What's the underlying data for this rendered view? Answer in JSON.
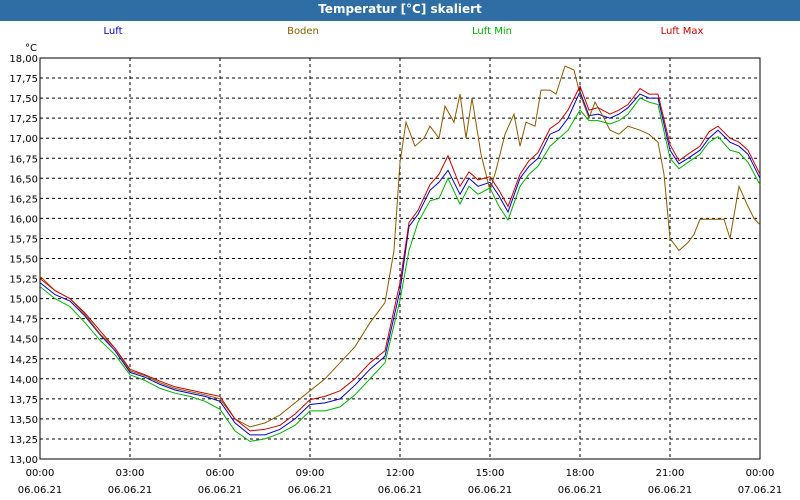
{
  "window": {
    "title": "Temperatur [°C] skaliert"
  },
  "chart_data": {
    "type": "line",
    "title": "Temperatur [°C] skaliert",
    "ylabel": "°C",
    "ylim": [
      13.0,
      18.0
    ],
    "yticks": [
      "13,00",
      "13,25",
      "13,50",
      "13,75",
      "14,00",
      "14,25",
      "14,50",
      "14,75",
      "15,00",
      "15,25",
      "15,50",
      "15,75",
      "16,00",
      "16,25",
      "16,50",
      "16,75",
      "17,00",
      "17,25",
      "17,50",
      "17,75",
      "18,00"
    ],
    "xlim": [
      0,
      24
    ],
    "xticks": [
      {
        "hour": 0,
        "time": "00:00",
        "date": "06.06.21"
      },
      {
        "hour": 3,
        "time": "03:00",
        "date": "06.06.21"
      },
      {
        "hour": 6,
        "time": "06:00",
        "date": "06.06.21"
      },
      {
        "hour": 9,
        "time": "09:00",
        "date": "06.06.21"
      },
      {
        "hour": 12,
        "time": "12:00",
        "date": "06.06.21"
      },
      {
        "hour": 15,
        "time": "15:00",
        "date": "06.06.21"
      },
      {
        "hour": 18,
        "time": "18:00",
        "date": "06.06.21"
      },
      {
        "hour": 21,
        "time": "21:00",
        "date": "06.06.21"
      },
      {
        "hour": 24,
        "time": "00:00",
        "date": "07.06.21"
      }
    ],
    "grid": true,
    "legend_position": "top",
    "series": [
      {
        "name": "Luft",
        "color": "#0000cc",
        "points": [
          [
            0,
            15.2
          ],
          [
            0.5,
            15.05
          ],
          [
            1,
            14.97
          ],
          [
            1.5,
            14.78
          ],
          [
            2,
            14.55
          ],
          [
            2.5,
            14.35
          ],
          [
            3,
            14.08
          ],
          [
            3.5,
            14.02
          ],
          [
            4,
            13.93
          ],
          [
            4.5,
            13.86
          ],
          [
            5,
            13.82
          ],
          [
            5.5,
            13.78
          ],
          [
            6,
            13.72
          ],
          [
            6.5,
            13.45
          ],
          [
            7,
            13.3
          ],
          [
            7.5,
            13.3
          ],
          [
            8,
            13.37
          ],
          [
            8.5,
            13.5
          ],
          [
            9,
            13.68
          ],
          [
            9.5,
            13.7
          ],
          [
            10,
            13.75
          ],
          [
            10.5,
            13.92
          ],
          [
            11,
            14.12
          ],
          [
            11.5,
            14.28
          ],
          [
            12,
            15.1
          ],
          [
            12.3,
            15.9
          ],
          [
            12.6,
            16.05
          ],
          [
            13,
            16.35
          ],
          [
            13.3,
            16.45
          ],
          [
            13.6,
            16.6
          ],
          [
            14,
            16.3
          ],
          [
            14.3,
            16.5
          ],
          [
            14.6,
            16.4
          ],
          [
            15,
            16.45
          ],
          [
            15.3,
            16.28
          ],
          [
            15.6,
            16.08
          ],
          [
            16,
            16.5
          ],
          [
            16.3,
            16.65
          ],
          [
            16.6,
            16.75
          ],
          [
            17,
            17.05
          ],
          [
            17.3,
            17.1
          ],
          [
            17.6,
            17.25
          ],
          [
            18,
            17.58
          ],
          [
            18.3,
            17.28
          ],
          [
            18.6,
            17.3
          ],
          [
            19,
            17.25
          ],
          [
            19.3,
            17.3
          ],
          [
            19.6,
            17.38
          ],
          [
            20,
            17.55
          ],
          [
            20.3,
            17.5
          ],
          [
            20.6,
            17.5
          ],
          [
            21,
            16.85
          ],
          [
            21.3,
            16.68
          ],
          [
            21.6,
            16.75
          ],
          [
            22,
            16.85
          ],
          [
            22.3,
            17.0
          ],
          [
            22.6,
            17.1
          ],
          [
            23,
            16.95
          ],
          [
            23.3,
            16.9
          ],
          [
            23.6,
            16.8
          ],
          [
            24,
            16.5
          ]
        ]
      },
      {
        "name": "Boden",
        "color": "#8b5a00",
        "points": [
          [
            0,
            15.28
          ],
          [
            0.5,
            15.1
          ],
          [
            1,
            15.0
          ],
          [
            1.5,
            14.8
          ],
          [
            2,
            14.56
          ],
          [
            2.5,
            14.38
          ],
          [
            3,
            14.1
          ],
          [
            3.5,
            14.04
          ],
          [
            4,
            13.95
          ],
          [
            4.5,
            13.88
          ],
          [
            5,
            13.84
          ],
          [
            5.5,
            13.8
          ],
          [
            6,
            13.75
          ],
          [
            6.5,
            13.5
          ],
          [
            7,
            13.4
          ],
          [
            7.5,
            13.45
          ],
          [
            8,
            13.55
          ],
          [
            8.5,
            13.7
          ],
          [
            9,
            13.85
          ],
          [
            9.5,
            14.0
          ],
          [
            10,
            14.2
          ],
          [
            10.5,
            14.4
          ],
          [
            11,
            14.7
          ],
          [
            11.5,
            14.95
          ],
          [
            11.8,
            15.6
          ],
          [
            12,
            16.7
          ],
          [
            12.2,
            17.2
          ],
          [
            12.5,
            16.9
          ],
          [
            12.8,
            17.0
          ],
          [
            13,
            17.15
          ],
          [
            13.3,
            17.0
          ],
          [
            13.5,
            17.4
          ],
          [
            13.8,
            17.2
          ],
          [
            14,
            17.55
          ],
          [
            14.2,
            17.0
          ],
          [
            14.4,
            17.5
          ],
          [
            14.7,
            16.8
          ],
          [
            15,
            16.35
          ],
          [
            15.2,
            16.6
          ],
          [
            15.5,
            17.05
          ],
          [
            15.8,
            17.3
          ],
          [
            16,
            16.9
          ],
          [
            16.2,
            17.2
          ],
          [
            16.5,
            17.15
          ],
          [
            16.7,
            17.6
          ],
          [
            17,
            17.6
          ],
          [
            17.2,
            17.55
          ],
          [
            17.5,
            17.9
          ],
          [
            17.8,
            17.85
          ],
          [
            18,
            17.55
          ],
          [
            18.3,
            17.25
          ],
          [
            18.5,
            17.45
          ],
          [
            18.8,
            17.25
          ],
          [
            19,
            17.1
          ],
          [
            19.3,
            17.05
          ],
          [
            19.6,
            17.15
          ],
          [
            20,
            17.1
          ],
          [
            20.3,
            17.05
          ],
          [
            20.6,
            16.95
          ],
          [
            20.8,
            16.55
          ],
          [
            21,
            15.75
          ],
          [
            21.3,
            15.6
          ],
          [
            21.6,
            15.7
          ],
          [
            21.8,
            15.8
          ],
          [
            22,
            15.99
          ],
          [
            22.5,
            15.99
          ],
          [
            22.8,
            15.99
          ],
          [
            23,
            15.75
          ],
          [
            23.3,
            16.4
          ],
          [
            23.6,
            16.15
          ],
          [
            23.8,
            16.0
          ],
          [
            24,
            15.92
          ]
        ]
      },
      {
        "name": "Luft Min",
        "color": "#00b000",
        "points": [
          [
            0,
            15.15
          ],
          [
            0.5,
            15.0
          ],
          [
            1,
            14.9
          ],
          [
            1.5,
            14.7
          ],
          [
            2,
            14.48
          ],
          [
            2.5,
            14.3
          ],
          [
            3,
            14.05
          ],
          [
            3.5,
            13.98
          ],
          [
            4,
            13.88
          ],
          [
            4.5,
            13.82
          ],
          [
            5,
            13.78
          ],
          [
            5.5,
            13.72
          ],
          [
            6,
            13.62
          ],
          [
            6.5,
            13.35
          ],
          [
            7,
            13.22
          ],
          [
            7.5,
            13.25
          ],
          [
            8,
            13.32
          ],
          [
            8.5,
            13.42
          ],
          [
            9,
            13.6
          ],
          [
            9.5,
            13.6
          ],
          [
            10,
            13.65
          ],
          [
            10.5,
            13.8
          ],
          [
            11,
            14.0
          ],
          [
            11.5,
            14.2
          ],
          [
            12,
            14.98
          ],
          [
            12.3,
            15.6
          ],
          [
            12.6,
            15.95
          ],
          [
            13,
            16.22
          ],
          [
            13.3,
            16.25
          ],
          [
            13.6,
            16.5
          ],
          [
            14,
            16.18
          ],
          [
            14.3,
            16.4
          ],
          [
            14.6,
            16.3
          ],
          [
            15,
            16.38
          ],
          [
            15.3,
            16.15
          ],
          [
            15.6,
            15.98
          ],
          [
            16,
            16.4
          ],
          [
            16.3,
            16.55
          ],
          [
            16.6,
            16.65
          ],
          [
            17,
            16.9
          ],
          [
            17.3,
            17.0
          ],
          [
            17.6,
            17.1
          ],
          [
            18,
            17.35
          ],
          [
            18.3,
            17.22
          ],
          [
            18.6,
            17.22
          ],
          [
            19,
            17.18
          ],
          [
            19.3,
            17.22
          ],
          [
            19.6,
            17.3
          ],
          [
            20,
            17.5
          ],
          [
            20.3,
            17.45
          ],
          [
            20.6,
            17.42
          ],
          [
            21,
            16.75
          ],
          [
            21.3,
            16.62
          ],
          [
            21.6,
            16.7
          ],
          [
            22,
            16.8
          ],
          [
            22.3,
            16.95
          ],
          [
            22.6,
            17.02
          ],
          [
            23,
            16.85
          ],
          [
            23.3,
            16.82
          ],
          [
            23.6,
            16.7
          ],
          [
            24,
            16.42
          ]
        ]
      },
      {
        "name": "Luft Max",
        "color": "#cc0000",
        "points": [
          [
            0,
            15.25
          ],
          [
            0.5,
            15.1
          ],
          [
            1,
            15.0
          ],
          [
            1.5,
            14.82
          ],
          [
            2,
            14.6
          ],
          [
            2.5,
            14.38
          ],
          [
            3,
            14.12
          ],
          [
            3.5,
            14.05
          ],
          [
            4,
            13.97
          ],
          [
            4.5,
            13.9
          ],
          [
            5,
            13.86
          ],
          [
            5.5,
            13.82
          ],
          [
            6,
            13.78
          ],
          [
            6.5,
            13.5
          ],
          [
            7,
            13.35
          ],
          [
            7.5,
            13.37
          ],
          [
            8,
            13.42
          ],
          [
            8.5,
            13.56
          ],
          [
            9,
            13.74
          ],
          [
            9.5,
            13.78
          ],
          [
            10,
            13.85
          ],
          [
            10.5,
            14.0
          ],
          [
            11,
            14.2
          ],
          [
            11.5,
            14.35
          ],
          [
            12,
            15.2
          ],
          [
            12.3,
            15.95
          ],
          [
            12.6,
            16.1
          ],
          [
            13,
            16.42
          ],
          [
            13.3,
            16.55
          ],
          [
            13.6,
            16.78
          ],
          [
            14,
            16.4
          ],
          [
            14.3,
            16.58
          ],
          [
            14.6,
            16.48
          ],
          [
            15,
            16.52
          ],
          [
            15.3,
            16.35
          ],
          [
            15.6,
            16.15
          ],
          [
            16,
            16.55
          ],
          [
            16.3,
            16.72
          ],
          [
            16.6,
            16.82
          ],
          [
            17,
            17.12
          ],
          [
            17.3,
            17.2
          ],
          [
            17.6,
            17.35
          ],
          [
            18,
            17.65
          ],
          [
            18.3,
            17.35
          ],
          [
            18.6,
            17.38
          ],
          [
            19,
            17.3
          ],
          [
            19.3,
            17.35
          ],
          [
            19.6,
            17.42
          ],
          [
            20,
            17.62
          ],
          [
            20.3,
            17.55
          ],
          [
            20.6,
            17.55
          ],
          [
            21,
            16.92
          ],
          [
            21.3,
            16.72
          ],
          [
            21.6,
            16.8
          ],
          [
            22,
            16.9
          ],
          [
            22.3,
            17.08
          ],
          [
            22.6,
            17.15
          ],
          [
            23,
            17.0
          ],
          [
            23.3,
            16.95
          ],
          [
            23.6,
            16.85
          ],
          [
            24,
            16.55
          ]
        ]
      }
    ]
  }
}
